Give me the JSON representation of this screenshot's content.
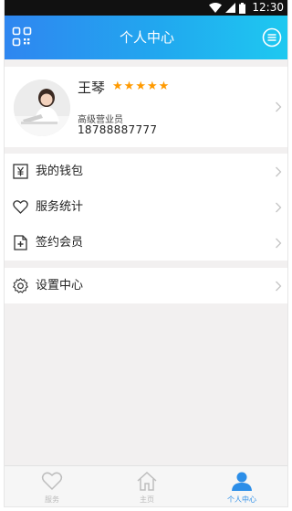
{
  "status_bar": {
    "time": "12:30"
  },
  "header": {
    "title": "个人中心"
  },
  "profile": {
    "name": "王琴",
    "rating": 5,
    "role": "高级营业员",
    "phone": "18788887777"
  },
  "menu": {
    "items": [
      {
        "label": "我的钱包",
        "icon": "wallet-icon"
      },
      {
        "label": "服务统计",
        "icon": "heart-icon"
      },
      {
        "label": "签约会员",
        "icon": "member-add-icon"
      }
    ],
    "settings": {
      "label": "设置中心",
      "icon": "gear-icon"
    }
  },
  "tab_bar": {
    "tabs": [
      {
        "label": "服务",
        "icon": "heart-icon"
      },
      {
        "label": "主页",
        "icon": "home-icon"
      },
      {
        "label": "个人中心",
        "icon": "person-icon",
        "active": true
      }
    ]
  },
  "colors": {
    "accent": "#2c8ee8",
    "star": "#ff9a00",
    "header_start": "#2f86f0",
    "header_end": "#1ec9f0"
  }
}
